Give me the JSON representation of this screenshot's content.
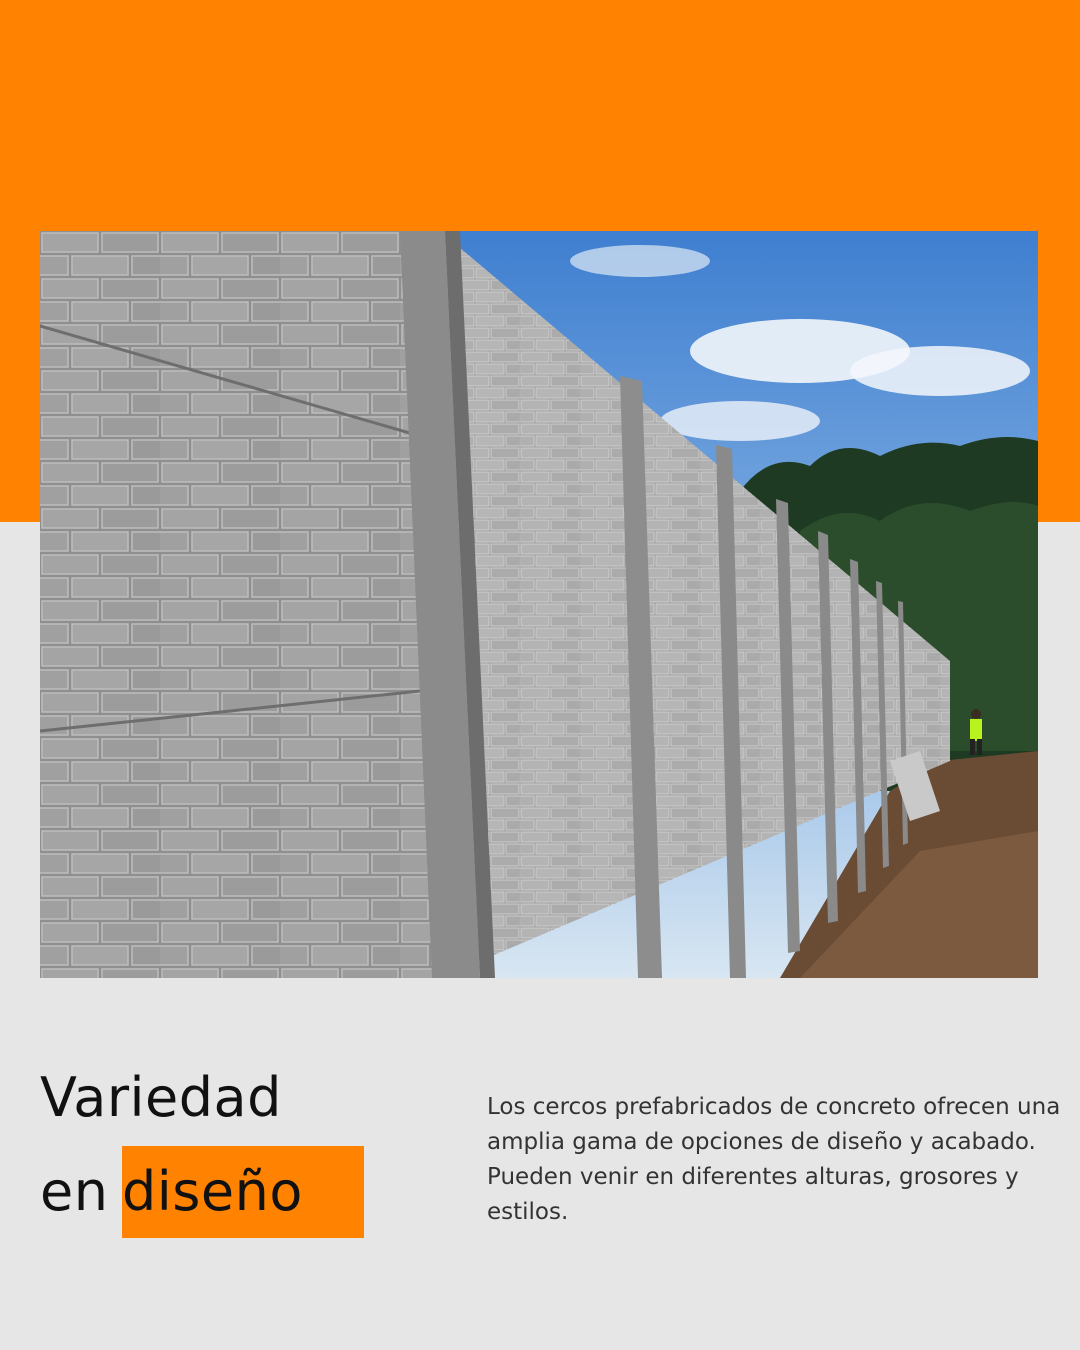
{
  "colors": {
    "accent": "#ff8200",
    "background": "#e6e6e6",
    "text_dark": "#111111",
    "text_body": "#333333"
  },
  "photo": {
    "icon": "concrete-brick-fence-photo"
  },
  "heading": {
    "line1": "Variedad",
    "line2_plain": "en",
    "line2_highlight": "diseño"
  },
  "description": {
    "lines": [
      "Los cercos prefabricados de concreto ofrecen una",
      "amplia gama de opciones de diseño y acabado.",
      "Pueden venir en diferentes alturas, grosores y",
      "estilos."
    ]
  }
}
